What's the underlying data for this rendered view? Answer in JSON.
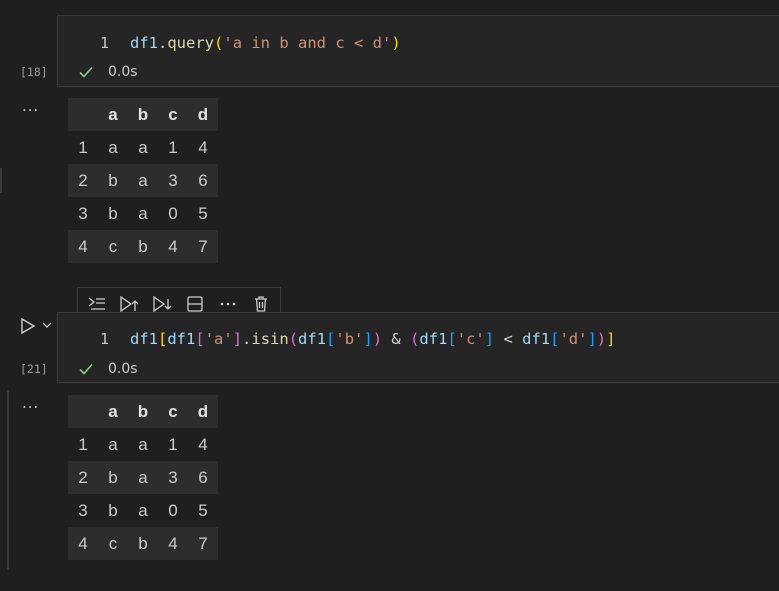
{
  "cells": [
    {
      "execution_count": "[18]",
      "line_number": "1",
      "code_tokens": [
        {
          "t": "df1",
          "c": "var"
        },
        {
          "t": ".",
          "c": "op"
        },
        {
          "t": "query",
          "c": "fn"
        },
        {
          "t": "(",
          "c": "p1"
        },
        {
          "t": "'a in b and c < d'",
          "c": "str"
        },
        {
          "t": ")",
          "c": "p1"
        }
      ],
      "status_time": "0.0s",
      "output_more": "...",
      "table": {
        "columns": [
          "",
          "a",
          "b",
          "c",
          "d"
        ],
        "rows": [
          [
            "1",
            "a",
            "a",
            "1",
            "4"
          ],
          [
            "2",
            "b",
            "a",
            "3",
            "6"
          ],
          [
            "3",
            "b",
            "a",
            "0",
            "5"
          ],
          [
            "4",
            "c",
            "b",
            "4",
            "7"
          ]
        ]
      }
    },
    {
      "execution_count": "[21]",
      "line_number": "1",
      "code_tokens": [
        {
          "t": "df1",
          "c": "var"
        },
        {
          "t": "[",
          "c": "p1"
        },
        {
          "t": "df1",
          "c": "var"
        },
        {
          "t": "[",
          "c": "p2"
        },
        {
          "t": "'a'",
          "c": "str"
        },
        {
          "t": "]",
          "c": "p2"
        },
        {
          "t": ".",
          "c": "op"
        },
        {
          "t": "isin",
          "c": "fn"
        },
        {
          "t": "(",
          "c": "p2"
        },
        {
          "t": "df1",
          "c": "var"
        },
        {
          "t": "[",
          "c": "p3"
        },
        {
          "t": "'b'",
          "c": "str"
        },
        {
          "t": "]",
          "c": "p3"
        },
        {
          "t": ")",
          "c": "p2"
        },
        {
          "t": " & ",
          "c": "op"
        },
        {
          "t": "(",
          "c": "p2"
        },
        {
          "t": "df1",
          "c": "var"
        },
        {
          "t": "[",
          "c": "p3"
        },
        {
          "t": "'c'",
          "c": "str"
        },
        {
          "t": "]",
          "c": "p3"
        },
        {
          "t": " < ",
          "c": "op"
        },
        {
          "t": "df1",
          "c": "var"
        },
        {
          "t": "[",
          "c": "p3"
        },
        {
          "t": "'d'",
          "c": "str"
        },
        {
          "t": "]",
          "c": "p3"
        },
        {
          "t": ")",
          "c": "p2"
        },
        {
          "t": "]",
          "c": "p1"
        }
      ],
      "status_time": "0.0s",
      "output_more": "...",
      "table": {
        "columns": [
          "",
          "a",
          "b",
          "c",
          "d"
        ],
        "rows": [
          [
            "1",
            "a",
            "a",
            "1",
            "4"
          ],
          [
            "2",
            "b",
            "a",
            "3",
            "6"
          ],
          [
            "3",
            "b",
            "a",
            "0",
            "5"
          ],
          [
            "4",
            "c",
            "b",
            "4",
            "7"
          ]
        ]
      }
    }
  ],
  "toolbar": {
    "icons": [
      "execute-above-icon",
      "execute-cell-and-above-icon",
      "execute-cell-and-below-icon",
      "split-cell-icon",
      "more-actions-icon",
      "delete-cell-icon"
    ],
    "more_label": "···"
  },
  "colors": {
    "background": "#1f1f1f",
    "editor_bg": "#252526",
    "check": "#89d185",
    "string": "#ce9178",
    "function": "#dcdcaa",
    "variable": "#9cdcfe"
  }
}
